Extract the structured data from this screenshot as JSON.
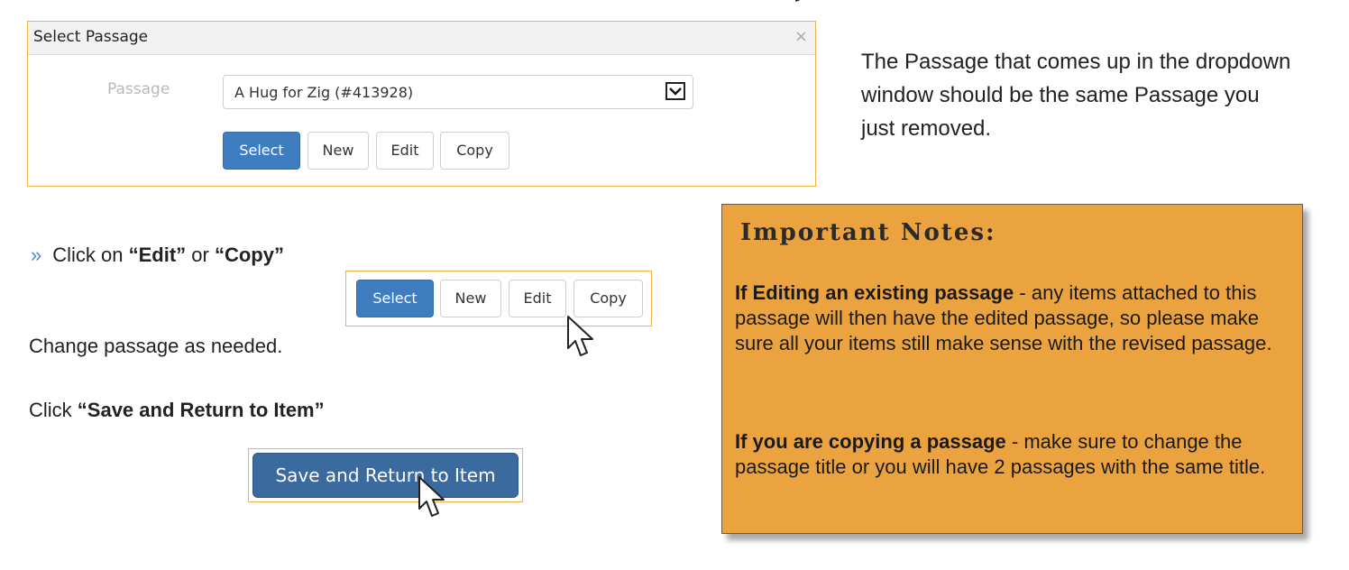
{
  "dialog": {
    "title": "Select Passage",
    "close": "×",
    "field_label": "Passage",
    "select_value": "A Hug for Zig (#413928)",
    "buttons": {
      "select": "Select",
      "new": "New",
      "edit": "Edit",
      "copy": "Copy"
    }
  },
  "right_text": "The Passage that comes up in the dropdown window should be the same Passage you just removed.",
  "instructions": {
    "bullet": "»",
    "click_on": "Click on ",
    "edit_quoted": "“Edit”",
    "or": " or ",
    "copy_quoted": "“Copy”",
    "change_passage": "Change passage as needed.",
    "click": "Click ",
    "save_quoted": "“Save and Return to Item”"
  },
  "button_group": {
    "select": "Select",
    "new": "New",
    "edit": "Edit",
    "copy": "Copy"
  },
  "save_button": "Save and Return to Item",
  "notes": {
    "title": "Important Notes:",
    "p1_bold": "If Editing an existing passage",
    "p1_rest": " - any items attached to this passage will then have the edited passage, so please make sure all your items still make sense with the revised passage.",
    "p2_bold": "If you are copying a passage",
    "p2_rest": " - make sure to change the passage title or you will have 2 passages with the same title."
  },
  "colors": {
    "accent_border": "#f0b04a",
    "primary_button": "#3f7dc1",
    "save_button": "#3a6a9e",
    "notes_bg": "#eba33f"
  },
  "icons": [
    "close-icon",
    "dropdown-arrow-icon",
    "mouse-pointer-icon"
  ]
}
